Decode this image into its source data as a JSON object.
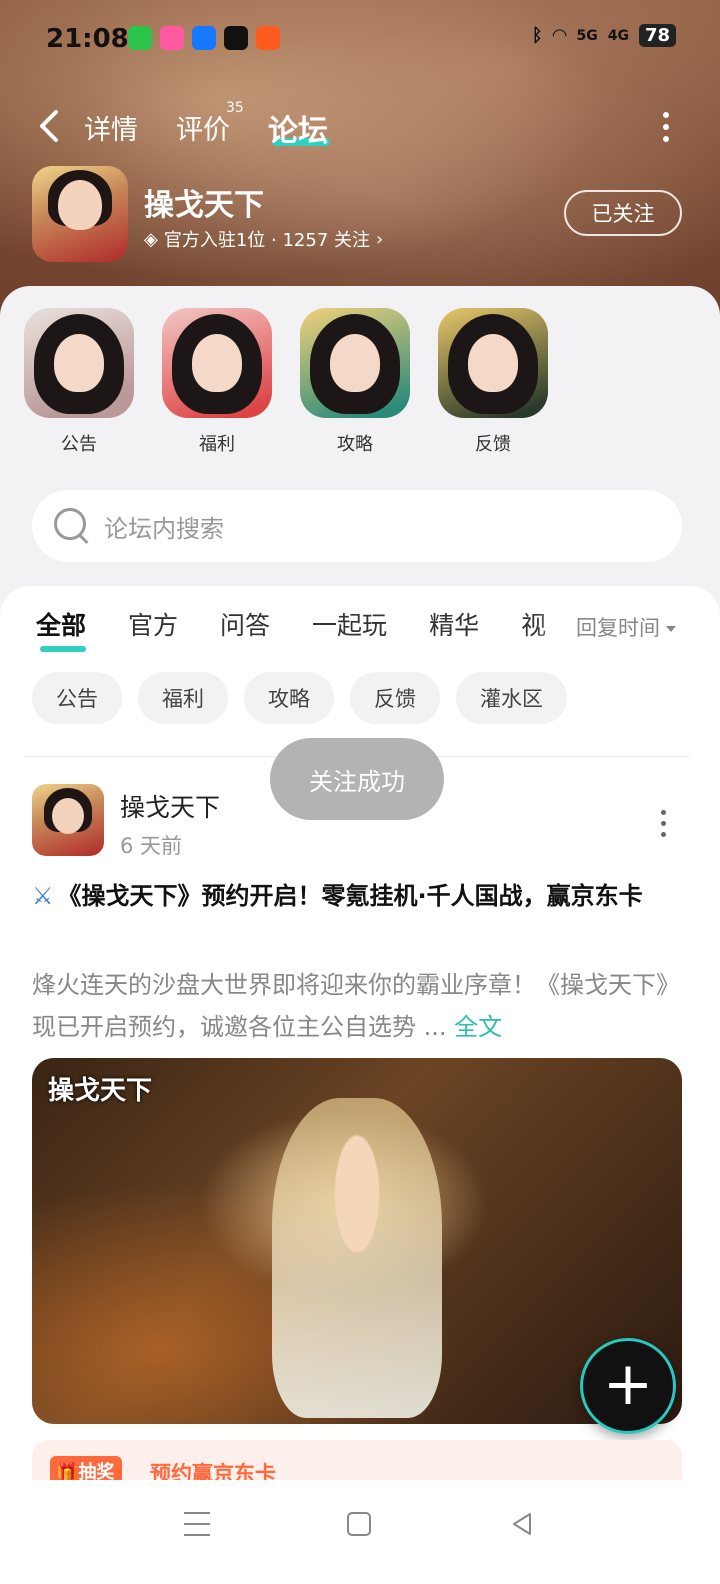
{
  "status_bar": {
    "time": "21:08",
    "signal_5g": "5G",
    "signal_4g": "4G",
    "battery": "78"
  },
  "top_nav": {
    "tabs": [
      {
        "label": "详情"
      },
      {
        "label": "评价",
        "badge": "35"
      },
      {
        "label": "论坛",
        "active": true
      }
    ]
  },
  "game": {
    "title": "操戈天下",
    "meta": "官方入驻1位 · 1257 关注",
    "follow_label": "已关注"
  },
  "categories": [
    {
      "label": "公告"
    },
    {
      "label": "福利"
    },
    {
      "label": "攻略"
    },
    {
      "label": "反馈"
    }
  ],
  "search": {
    "placeholder": "论坛内搜索"
  },
  "filter_tabs": [
    "全部",
    "官方",
    "问答",
    "一起玩",
    "精华",
    "视"
  ],
  "sort_label": "回复时间",
  "chips": [
    "公告",
    "福利",
    "攻略",
    "反馈",
    "灌水区"
  ],
  "toast": "关注成功",
  "post": {
    "author": "操戈天下",
    "time": "6 天前",
    "title": "《操戈天下》预约开启！零氪挂机·千人国战，赢京东卡",
    "body": "烽火连天的沙盘大世界即将迎来你的霸业序章！《操戈天下》现已开启预约，诚邀各位主公自选势",
    "ellipsis": "...",
    "full_text": "全文",
    "image_logo": "操戈天下"
  },
  "promo": {
    "tag": "抽奖",
    "text": "预约赢京东卡"
  },
  "colors": {
    "accent": "#2fd0c0",
    "promo": "#ff6a3d"
  }
}
